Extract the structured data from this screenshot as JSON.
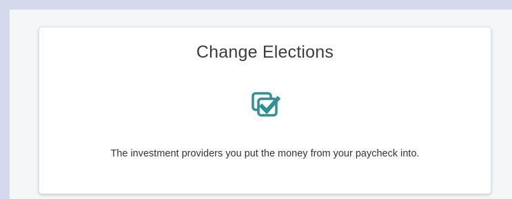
{
  "card": {
    "title": "Change Elections",
    "description": "The investment providers you put the money from your paycheck into.",
    "icon": "change-elections-check-icon"
  },
  "colors": {
    "background": "#d4daeb",
    "panel": "#f5f6f8",
    "card": "#ffffff",
    "accent": "#2e8f94",
    "text": "#333333"
  }
}
